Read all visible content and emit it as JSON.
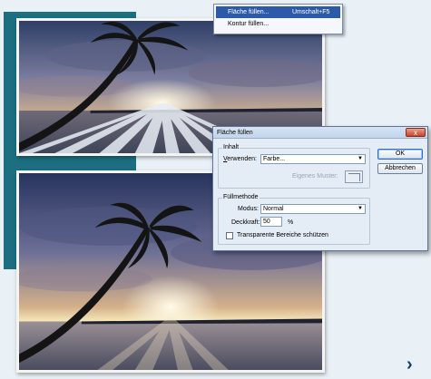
{
  "menu": {
    "items": [
      {
        "label": "Fläche füllen...",
        "shortcut": "Umschalt+F5"
      },
      {
        "label": "Kontur füllen...",
        "shortcut": ""
      }
    ]
  },
  "dialog": {
    "title": "Fläche füllen",
    "close": "x",
    "content_group": {
      "title": "Inhalt",
      "use_label": "Verwenden:",
      "use_value": "Farbe...",
      "custom_pattern_label": "Eigenes Muster:"
    },
    "fill_group": {
      "title": "Füllmethode",
      "mode_label": "Modus:",
      "mode_value": "Normal",
      "opacity_label": "Deckkraft:",
      "opacity_value": "50",
      "opacity_unit": "%",
      "preserve_label": "Transparente Bereiche schützen"
    },
    "ok_label": "OK",
    "cancel_label": "Abbrechen"
  },
  "nav": {
    "next_glyph": "›"
  },
  "colors": {
    "teal": "#1c6f80",
    "menu_highlight": "#2d5aa8",
    "arrow": "#0f3f72"
  }
}
